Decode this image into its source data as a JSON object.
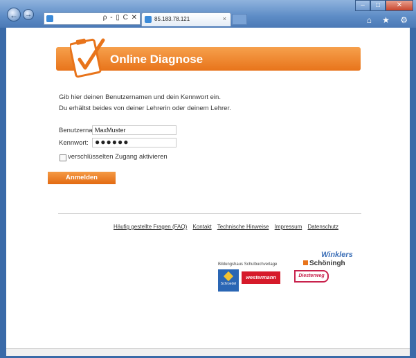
{
  "browser": {
    "address": "",
    "address_tools": "ρ - ▯ C ✕",
    "tab_title": "85.183.78.121",
    "tab_close": "×",
    "back_glyph": "←",
    "forward_glyph": "→",
    "win_min": "–",
    "win_max": "□",
    "win_close": "✕",
    "right_tools": "⌂ ★ ⚙"
  },
  "header": {
    "title": "Online Diagnose"
  },
  "intro": {
    "line1": "Gib hier deinen Benutzernamen und dein Kennwort ein.",
    "line2": "Du erhältst beides von deiner Lehrerin oder deinem Lehrer."
  },
  "form": {
    "username_label": "Benutzername:",
    "username_value": "MaxMuster",
    "password_label": "Kennwort:",
    "password_value": "●●●●●●",
    "checkbox_label": "verschlüsselten Zugang aktivieren",
    "submit_label": "Anmelden"
  },
  "footer": {
    "links": [
      "Häufig gestellte Fragen (FAQ)",
      "Kontakt",
      "Technische Hinweise",
      "Impressum",
      "Datenschutz"
    ]
  },
  "publishers": {
    "winklers": "Winklers",
    "schoeningh": "Schöningh",
    "bildungshaus": "Bildungshaus Schulbuchverlage",
    "schroedel": "Schroedel",
    "westermann": "westermann",
    "diesterweg": "Diesterweg"
  },
  "colors": {
    "accent": "#e8741b",
    "westermann": "#d61a2a",
    "diesterweg": "#c8224c",
    "schroedel": "#2a66b4"
  }
}
